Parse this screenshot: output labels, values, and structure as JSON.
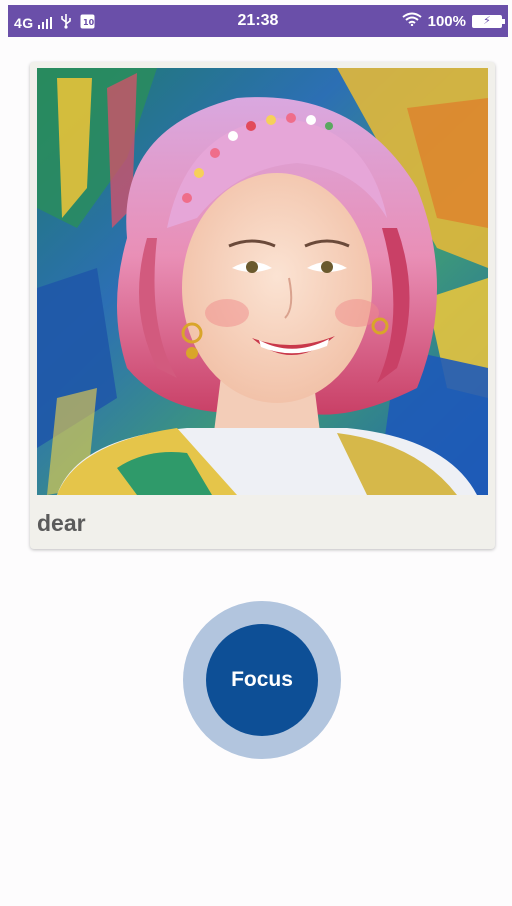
{
  "status_bar": {
    "network": "4G",
    "time": "21:38",
    "battery": "100%",
    "icons": [
      "signal-icon",
      "usb-icon",
      "notification-icon",
      "wifi-icon",
      "battery-charging-icon"
    ],
    "background_color": "#6a4fa9"
  },
  "card": {
    "title": "dear",
    "image_icon": "portrait-painting-image"
  },
  "focus": {
    "label": "Focus",
    "button_color": "#0d4f96",
    "ring_color": "#b2c5de"
  }
}
